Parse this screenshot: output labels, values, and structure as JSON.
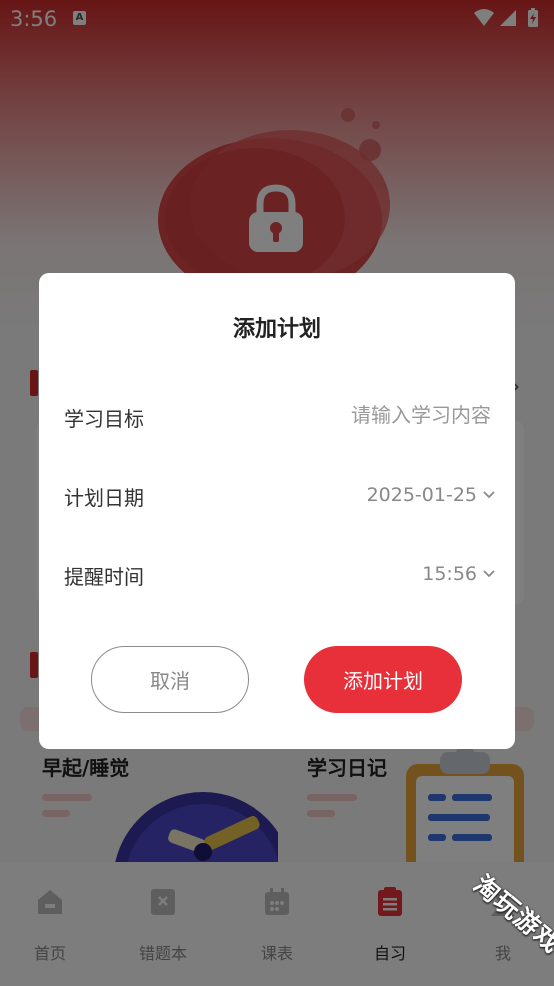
{
  "status_bar": {
    "time": "3:56",
    "notification_icon": "a-text-icon",
    "wifi_icon": "wifi-icon",
    "signal_icon": "signal-icon",
    "battery_icon": "battery-charging-icon"
  },
  "background": {
    "hero_icon": "lock-icon",
    "tiles": [
      {
        "title": "早起/睡觉"
      },
      {
        "title": "学习日记"
      }
    ]
  },
  "bottom_nav": {
    "items": [
      {
        "label": "首页",
        "icon": "home-icon"
      },
      {
        "label": "错题本",
        "icon": "notebook-icon"
      },
      {
        "label": "课表",
        "icon": "calendar-icon"
      },
      {
        "label": "自习",
        "icon": "clipboard-icon",
        "active": true
      },
      {
        "label": "我",
        "icon": "user-icon"
      }
    ]
  },
  "dialog": {
    "title": "添加计划",
    "goal": {
      "label": "学习目标",
      "placeholder": "请输入学习内容",
      "value": ""
    },
    "date": {
      "label": "计划日期",
      "value": "2025-01-25"
    },
    "reminder": {
      "label": "提醒时间",
      "value": "15:56"
    },
    "cancel_label": "取消",
    "confirm_label": "添加计划"
  },
  "watermark": "淘玩游戏",
  "colors": {
    "accent": "#e7303a",
    "header_red": "#cf2b2b",
    "overlay": "rgba(0,0,0,0.5)"
  }
}
